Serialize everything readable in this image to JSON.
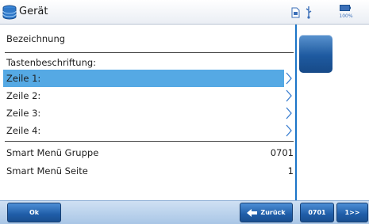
{
  "header": {
    "title": "Gerät",
    "app_icon": "database-icon",
    "status_icons": [
      "sd-card-icon",
      "usb-icon",
      "battery-icon"
    ],
    "battery_percent": "100%"
  },
  "form": {
    "bezeichnung_label": "Bezeichnung",
    "tastenbeschriftung_label": "Tastenbeschriftung:",
    "zeilen": [
      {
        "label": "Zeile 1:"
      },
      {
        "label": "Zeile 2:"
      },
      {
        "label": "Zeile 3:"
      },
      {
        "label": "Zeile 4:"
      }
    ],
    "selected_index": 0,
    "smart_menu_gruppe_label": "Smart Menü Gruppe",
    "smart_menu_gruppe_value": "0701",
    "smart_menu_seite_label": "Smart Menü Seite",
    "smart_menu_seite_value": "1"
  },
  "footer": {
    "ok_label": "Ok",
    "back_label": "Zurück",
    "group_label": "0701",
    "next_label": "1>>"
  },
  "colors": {
    "selection": "#55a9e4",
    "accent": "#1b75c8",
    "button": "#1f5da8"
  }
}
